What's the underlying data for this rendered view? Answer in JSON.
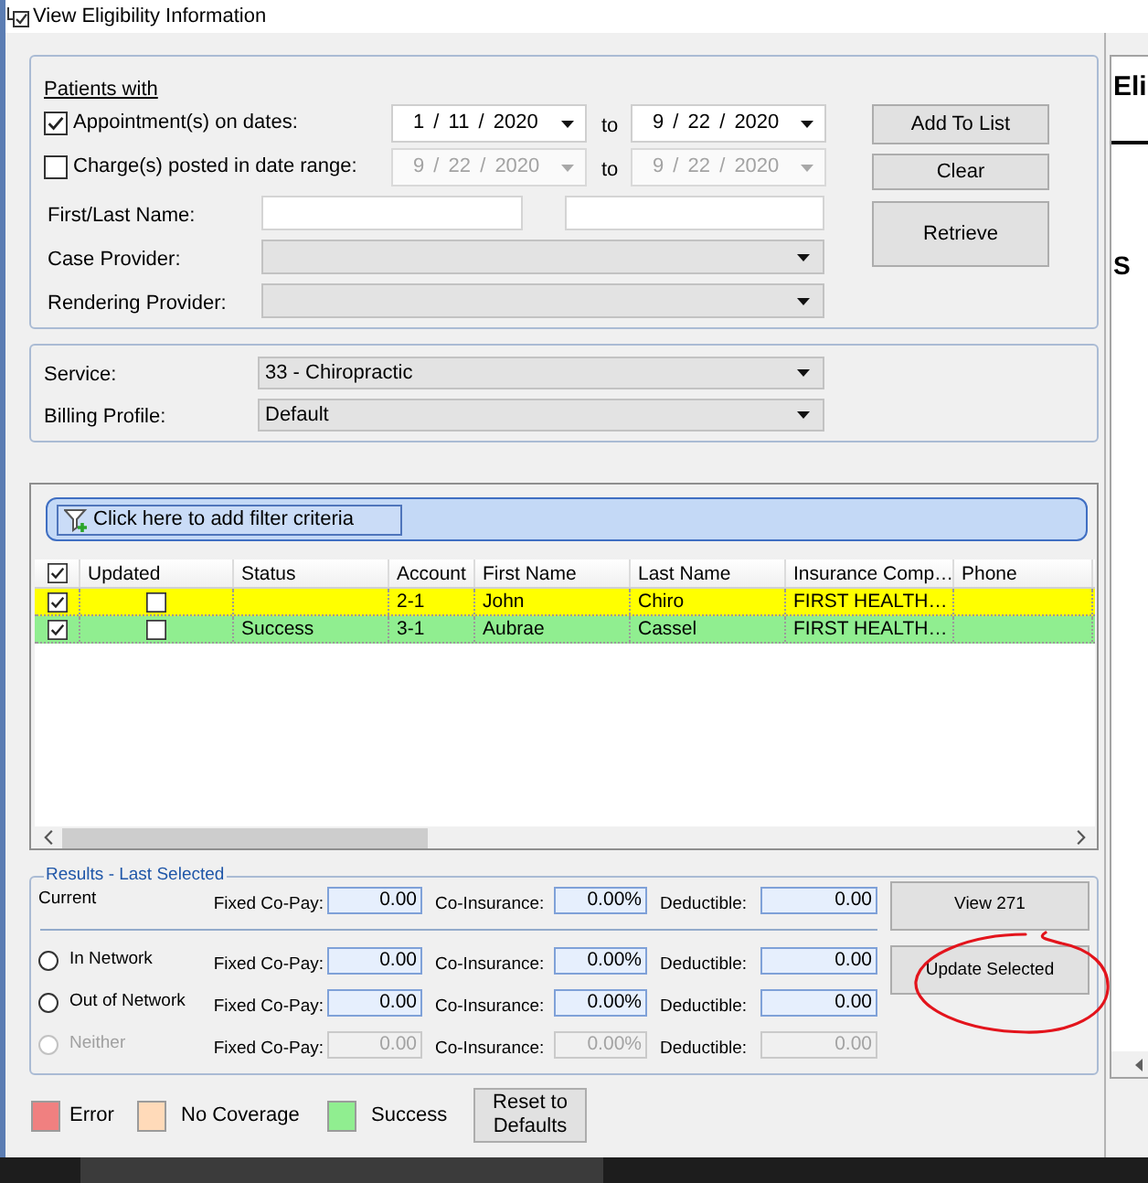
{
  "window": {
    "title": "View Eligibility Information"
  },
  "patients": {
    "heading": "Patients with",
    "date_rows": [
      {
        "label": "Appointment(s) on dates:",
        "checked": true,
        "from": "1 / 11 / 2020",
        "to_label": "to",
        "to": "9 / 22 / 2020"
      },
      {
        "label": "Charge(s) posted in date range:",
        "checked": false,
        "from": "9 / 22 / 2020",
        "to_label": "to",
        "to": "9 / 22 / 2020"
      }
    ],
    "name_label": "First/Last Name:",
    "providers": [
      {
        "label": "Case Provider:"
      },
      {
        "label": "Rendering Provider:"
      }
    ],
    "buttons": [
      {
        "label": "Add To List"
      },
      {
        "label": "Clear"
      },
      {
        "label": "Retrieve"
      }
    ]
  },
  "options": {
    "fields": [
      {
        "label": "Service:",
        "value": "33 - Chiropractic"
      },
      {
        "label": "Billing Profile:",
        "value": "Default"
      }
    ]
  },
  "grid": {
    "filter_button": "Click here to add filter criteria",
    "all_checked": true,
    "columns": [
      "Updated",
      "Status",
      "Account",
      "First Name",
      "Last Name",
      "Insurance Comp…",
      "Phone"
    ],
    "rows": [
      {
        "checked": true,
        "updated": false,
        "account": "2-1",
        "first_name": "John",
        "last_name": "Chiro",
        "insurance": "FIRST HEALTH…",
        "color": "#ffff00"
      },
      {
        "checked": true,
        "updated": false,
        "status": "Success",
        "account": "3-1",
        "first_name": "Aubrae",
        "last_name": "Cassel",
        "insurance": "FIRST HEALTH…",
        "color": "#90ee90"
      }
    ]
  },
  "results": {
    "legend": "Results - Last Selected",
    "current": {
      "label": "Current",
      "copay_label": "Fixed Co-Pay:",
      "copay": "0.00",
      "coinsurance_label": "Co-Insurance:",
      "coinsurance": "0.00%",
      "deductible_label": "Deductible:",
      "deductible": "0.00"
    },
    "networks": [
      {
        "label": "In Network",
        "selected": false,
        "disabled": false,
        "copay_label": "Fixed Co-Pay:",
        "copay": "0.00",
        "coinsurance_label": "Co-Insurance:",
        "coinsurance": "0.00%",
        "deductible_label": "Deductible:",
        "deductible": "0.00"
      },
      {
        "label": "Out of Network",
        "selected": false,
        "disabled": false,
        "copay_label": "Fixed Co-Pay:",
        "copay": "0.00",
        "coinsurance_label": "Co-Insurance:",
        "coinsurance": "0.00%",
        "deductible_label": "Deductible:",
        "deductible": "0.00"
      },
      {
        "label": "Neither",
        "selected": false,
        "disabled": true,
        "copay_label": "Fixed Co-Pay:",
        "copay": "0.00",
        "coinsurance_label": "Co-Insurance:",
        "coinsurance": "0.00%",
        "deductible_label": "Deductible:",
        "deductible": "0.00"
      }
    ],
    "buttons": [
      {
        "label": "View 271",
        "circled": false
      },
      {
        "label": "Update Selected",
        "circled": true
      }
    ]
  },
  "legend": {
    "items": [
      {
        "label": "Error",
        "color": "#f08080"
      },
      {
        "label": "No Coverage",
        "color": "#ffdab9"
      },
      {
        "label": "Success",
        "color": "#90ee90"
      }
    ],
    "reset_button": "Reset to Defaults"
  },
  "side_panel": {
    "heading": "Eli",
    "text": "S"
  }
}
